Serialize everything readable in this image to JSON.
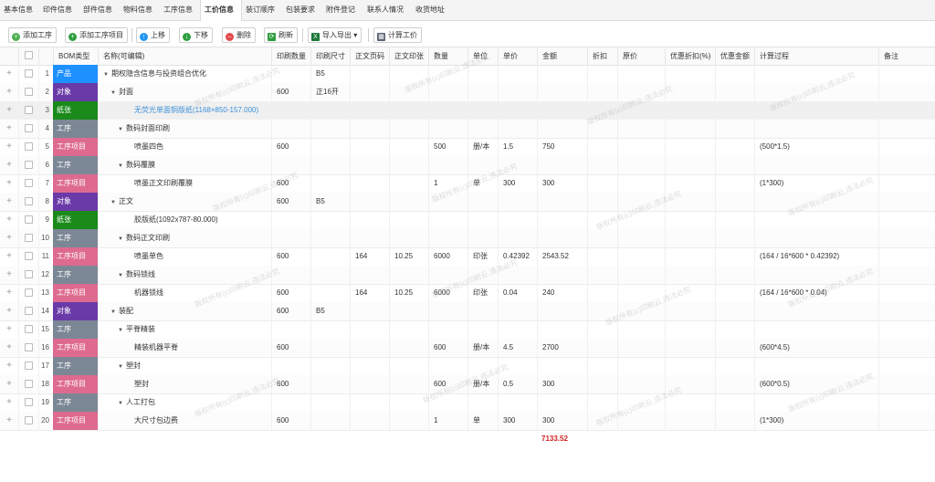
{
  "tabs": [
    {
      "label": "基本信息",
      "active": false
    },
    {
      "label": "印件信息",
      "active": false
    },
    {
      "label": "部件信息",
      "active": false
    },
    {
      "label": "物料信息",
      "active": false
    },
    {
      "label": "工序信息",
      "active": false
    },
    {
      "label": "工价信息",
      "active": true
    },
    {
      "label": "装订顺序",
      "active": false
    },
    {
      "label": "包装要求",
      "active": false
    },
    {
      "label": "附件登记",
      "active": false
    },
    {
      "label": "联系人情况",
      "active": false
    },
    {
      "label": "收货地址",
      "active": false
    }
  ],
  "toolbar": {
    "add_process": "添加工序",
    "add_process_item": "添加工序项目",
    "move_up": "上移",
    "move_down": "下移",
    "delete": "删除",
    "refresh": "刷新",
    "import_export": "导入导出",
    "calc_price": "计算工价"
  },
  "columns": {
    "bom_type": "BOM类型",
    "name": "名称(可编辑)",
    "print_qty": "印刷数量",
    "print_size": "印刷尺寸",
    "text_pages": "正文页码",
    "text_sheets": "正文印张",
    "qty": "数量",
    "unit": "单位",
    "unit_price": "单价",
    "amount": "金额",
    "discount": "折扣",
    "orig_price": "原价",
    "disc_pct": "优惠折扣(%)",
    "disc_amt": "优惠金额",
    "calc": "计算过程",
    "remark": "备注"
  },
  "colors": {
    "product": "#1e90ff",
    "object": "#6a3aa8",
    "paper": "#1a8a1a",
    "process": "#7c8796",
    "process_item": "#de6b8f",
    "link": "#3b8fd9",
    "total": "#d02020"
  },
  "rows": [
    {
      "no": "1",
      "type": "产品",
      "tcls": "t-product",
      "indent": 0,
      "arrow": true,
      "name": "期权隐含信息与投资组合优化",
      "print_qty": "",
      "print_size": "B5",
      "text_pages": "",
      "text_sheets": "",
      "qty": "",
      "unit": "",
      "unit_price": "",
      "amount": "",
      "calc": ""
    },
    {
      "no": "2",
      "type": "对象",
      "tcls": "t-object",
      "indent": 1,
      "arrow": true,
      "name": "封面",
      "print_qty": "600",
      "print_size": "正16开",
      "text_pages": "",
      "text_sheets": "",
      "qty": "",
      "unit": "",
      "unit_price": "",
      "amount": "",
      "calc": ""
    },
    {
      "no": "3",
      "type": "纸张",
      "tcls": "t-paper",
      "indent": 3,
      "arrow": false,
      "link": true,
      "name": "无荧光单面铜版纸(1168×850-157.000)",
      "print_qty": "",
      "print_size": "",
      "text_pages": "",
      "text_sheets": "",
      "qty": "",
      "unit": "",
      "unit_price": "",
      "amount": "",
      "calc": ""
    },
    {
      "no": "4",
      "type": "工序",
      "tcls": "t-proc",
      "indent": 2,
      "arrow": true,
      "name": "数码封面印刷",
      "print_qty": "",
      "print_size": "",
      "text_pages": "",
      "text_sheets": "",
      "qty": "",
      "unit": "",
      "unit_price": "",
      "amount": "",
      "calc": ""
    },
    {
      "no": "5",
      "type": "工序项目",
      "tcls": "t-item",
      "indent": 3,
      "arrow": false,
      "name": "喷墨四色",
      "print_qty": "600",
      "print_size": "",
      "text_pages": "",
      "text_sheets": "",
      "qty": "500",
      "unit": "册/本",
      "unit_price": "1.5",
      "amount": "750",
      "calc": "(500*1.5)"
    },
    {
      "no": "6",
      "type": "工序",
      "tcls": "t-proc",
      "indent": 2,
      "arrow": true,
      "name": "数码覆膜",
      "print_qty": "",
      "print_size": "",
      "text_pages": "",
      "text_sheets": "",
      "qty": "",
      "unit": "",
      "unit_price": "",
      "amount": "",
      "calc": ""
    },
    {
      "no": "7",
      "type": "工序项目",
      "tcls": "t-item",
      "indent": 3,
      "arrow": false,
      "name": "喷墨正文印刷覆膜",
      "print_qty": "600",
      "print_size": "",
      "text_pages": "",
      "text_sheets": "",
      "qty": "1",
      "unit": "单",
      "unit_price": "300",
      "amount": "300",
      "calc": "(1*300)"
    },
    {
      "no": "8",
      "type": "对象",
      "tcls": "t-object",
      "indent": 1,
      "arrow": true,
      "name": "正文",
      "print_qty": "600",
      "print_size": "B5",
      "text_pages": "",
      "text_sheets": "",
      "qty": "",
      "unit": "",
      "unit_price": "",
      "amount": "",
      "calc": ""
    },
    {
      "no": "9",
      "type": "纸张",
      "tcls": "t-paper",
      "indent": 3,
      "arrow": false,
      "name": "胶版纸(1092x787-80.000)",
      "print_qty": "",
      "print_size": "",
      "text_pages": "",
      "text_sheets": "",
      "qty": "",
      "unit": "",
      "unit_price": "",
      "amount": "",
      "calc": ""
    },
    {
      "no": "10",
      "type": "工序",
      "tcls": "t-proc",
      "indent": 2,
      "arrow": true,
      "name": "数码正文印刷",
      "print_qty": "",
      "print_size": "",
      "text_pages": "",
      "text_sheets": "",
      "qty": "",
      "unit": "",
      "unit_price": "",
      "amount": "",
      "calc": ""
    },
    {
      "no": "11",
      "type": "工序项目",
      "tcls": "t-item",
      "indent": 3,
      "arrow": false,
      "name": "喷墨单色",
      "print_qty": "600",
      "print_size": "",
      "text_pages": "164",
      "text_sheets": "10.25",
      "qty": "6000",
      "unit": "印张",
      "unit_price": "0.42392",
      "amount": "2543.52",
      "calc": "(164 / 16*600 * 0.42392)"
    },
    {
      "no": "12",
      "type": "工序",
      "tcls": "t-proc",
      "indent": 2,
      "arrow": true,
      "name": "数码锁线",
      "print_qty": "",
      "print_size": "",
      "text_pages": "",
      "text_sheets": "",
      "qty": "",
      "unit": "",
      "unit_price": "",
      "amount": "",
      "calc": ""
    },
    {
      "no": "13",
      "type": "工序项目",
      "tcls": "t-item",
      "indent": 3,
      "arrow": false,
      "name": "机器锁线",
      "print_qty": "600",
      "print_size": "",
      "text_pages": "164",
      "text_sheets": "10.25",
      "qty": "6000",
      "unit": "印张",
      "unit_price": "0.04",
      "amount": "240",
      "calc": "(164 / 16*600 * 0.04)"
    },
    {
      "no": "14",
      "type": "对象",
      "tcls": "t-object",
      "indent": 1,
      "arrow": true,
      "name": "装配",
      "print_qty": "600",
      "print_size": "B5",
      "text_pages": "",
      "text_sheets": "",
      "qty": "",
      "unit": "",
      "unit_price": "",
      "amount": "",
      "calc": ""
    },
    {
      "no": "15",
      "type": "工序",
      "tcls": "t-proc",
      "indent": 2,
      "arrow": true,
      "name": "平脊精装",
      "print_qty": "",
      "print_size": "",
      "text_pages": "",
      "text_sheets": "",
      "qty": "",
      "unit": "",
      "unit_price": "",
      "amount": "",
      "calc": ""
    },
    {
      "no": "16",
      "type": "工序项目",
      "tcls": "t-item",
      "indent": 3,
      "arrow": false,
      "name": "精装机器平脊",
      "print_qty": "600",
      "print_size": "",
      "text_pages": "",
      "text_sheets": "",
      "qty": "600",
      "unit": "册/本",
      "unit_price": "4.5",
      "amount": "2700",
      "calc": "(600*4.5)"
    },
    {
      "no": "17",
      "type": "工序",
      "tcls": "t-proc",
      "indent": 2,
      "arrow": true,
      "name": "塑封",
      "print_qty": "",
      "print_size": "",
      "text_pages": "",
      "text_sheets": "",
      "qty": "",
      "unit": "",
      "unit_price": "",
      "amount": "",
      "calc": ""
    },
    {
      "no": "18",
      "type": "工序项目",
      "tcls": "t-item",
      "indent": 3,
      "arrow": false,
      "name": "塑封",
      "print_qty": "600",
      "print_size": "",
      "text_pages": "",
      "text_sheets": "",
      "qty": "600",
      "unit": "册/本",
      "unit_price": "0.5",
      "amount": "300",
      "calc": "(600*0.5)"
    },
    {
      "no": "19",
      "type": "工序",
      "tcls": "t-proc",
      "indent": 2,
      "arrow": true,
      "name": "人工打包",
      "print_qty": "",
      "print_size": "",
      "text_pages": "",
      "text_sheets": "",
      "qty": "",
      "unit": "",
      "unit_price": "",
      "amount": "",
      "calc": ""
    },
    {
      "no": "20",
      "type": "工序项目",
      "tcls": "t-item",
      "indent": 3,
      "arrow": false,
      "name": "大尺寸包边费",
      "print_qty": "600",
      "print_size": "",
      "text_pages": "",
      "text_sheets": "",
      "qty": "1",
      "unit": "单",
      "unit_price": "300",
      "amount": "300",
      "calc": "(1*300)"
    }
  ],
  "total_amount": "7133.52",
  "watermark": "版权所有(c)印刷云,违法必究"
}
